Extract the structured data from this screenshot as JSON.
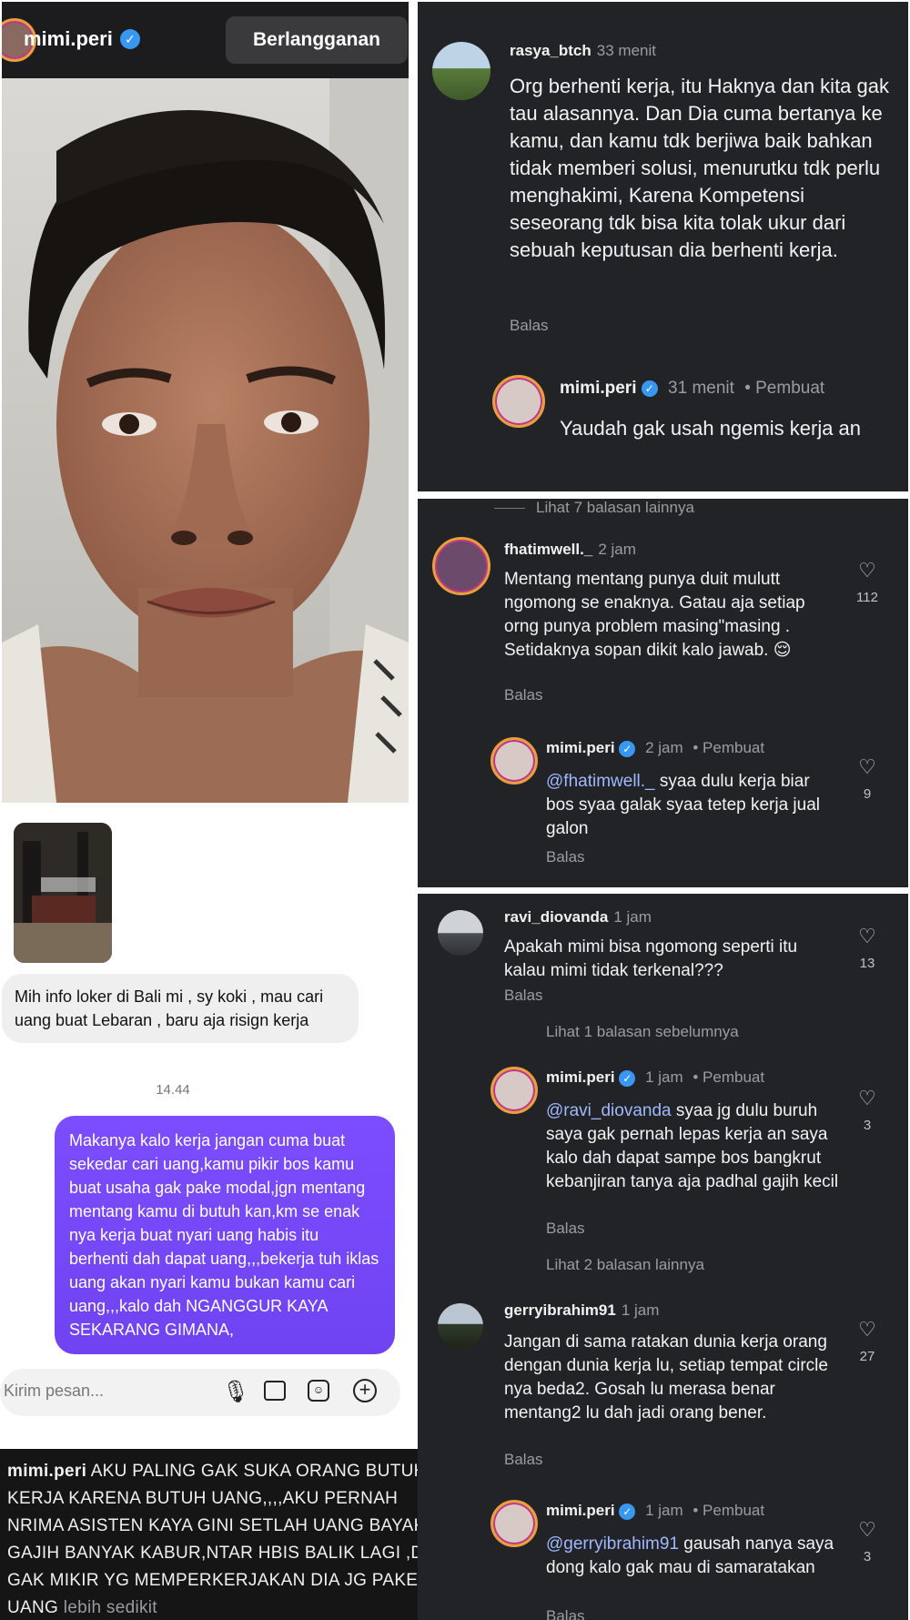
{
  "profile": {
    "username": "mimi.peri",
    "subscribe_label": "Berlangganan"
  },
  "dm": {
    "received_message": "Mih info loker di Bali mi , sy koki , mau cari uang buat Lebaran , baru aja risign kerja",
    "timestamp": "14.44",
    "sent_message": "Makanya kalo kerja jangan cuma buat sekedar cari uang,kamu pikir bos kamu buat usaha gak pake modal,jgn mentang mentang kamu di butuh kan,km se enak nya kerja buat nyari uang habis itu berhenti dah dapat uang,,,bekerja tuh iklas uang akan nyari kamu bukan kamu cari uang,,,kalo dah NGANGGUR KAYA SEKARANG GIMANA,",
    "input_placeholder": "Kirim pesan..."
  },
  "caption": {
    "username": "mimi.peri",
    "text": "AKU PALING GAK SUKA ORANG BUTUH KERJA KARENA BUTUH UANG,,,,AKU PERNAH NRIMA ASISTEN KAYA GINI SETLAH UANG BAYAK GAJIH BANYAK KABUR,NTAR HBIS BALIK LAGI ,DIA GAK MIKIR YG MEMPERKERJAKAN DIA JG PAKE UANG",
    "more_label": "lebih sedikit"
  },
  "panel1": {
    "comment": {
      "username": "rasya_btch",
      "time": "33 menit",
      "text": "Org berhenti kerja, itu Haknya dan kita gak tau alasannya. Dan Dia cuma bertanya ke kamu, dan kamu tdk berjiwa baik bahkan tidak memberi solusi, menurutku tdk perlu menghakimi,  Karena Kompetensi seseorang tdk bisa kita tolak ukur dari sebuah keputusan dia berhenti kerja.",
      "reply_label": "Balas"
    },
    "reply": {
      "username": "mimi.peri",
      "time": "31 menit",
      "creator_label": "• Pembuat",
      "text": "Yaudah gak usah ngemis kerja an"
    }
  },
  "panel2": {
    "view_more": "Lihat 7 balasan lainnya",
    "comment": {
      "username": "fhatimwell._",
      "time": "2 jam",
      "text": "Mentang mentang punya duit mulutt ngomong se enaknya. Gatau aja setiap orng punya problem masing\"masing . Setidaknya sopan dikit kalo jawab. 😌",
      "reply_label": "Balas",
      "likes": "112"
    },
    "reply": {
      "username": "mimi.peri",
      "time": "2 jam",
      "creator_label": "• Pembuat",
      "mention": "@fhatimwell._",
      "text": " syaa dulu kerja biar bos syaa galak syaa tetep kerja jual galon",
      "reply_label": "Balas",
      "likes": "9"
    }
  },
  "panel3": {
    "comment1": {
      "username": "ravi_diovanda",
      "time": "1 jam",
      "text": "Apakah mimi bisa ngomong seperti itu kalau mimi tidak terkenal???",
      "reply_label": "Balas",
      "likes": "13"
    },
    "view_prev": "Lihat 1 balasan sebelumnya",
    "reply1": {
      "username": "mimi.peri",
      "time": "1 jam",
      "creator_label": "• Pembuat",
      "mention": "@ravi_diovanda",
      "text": " syaa jg dulu buruh saya gak pernah lepas kerja an saya kalo dah dapat sampe bos bangkrut kebanjiran tanya aja padhal gajih kecil",
      "reply_label": "Balas",
      "likes": "3"
    },
    "view_more": "Lihat 2 balasan lainnya",
    "comment2": {
      "username": "gerryibrahim91",
      "time": "1 jam",
      "text": "Jangan di sama ratakan dunia kerja orang dengan dunia kerja lu, setiap tempat circle nya beda2. Gosah lu merasa benar mentang2 lu dah jadi orang bener.",
      "reply_label": "Balas",
      "likes": "27"
    },
    "reply2": {
      "username": "mimi.peri",
      "time": "1 jam",
      "creator_label": "• Pembuat",
      "mention": "@gerryibrahim91",
      "text": " gausah nanya saya dong kalo gak mau di samaratakan",
      "reply_label": "Balas",
      "likes": "3"
    }
  }
}
